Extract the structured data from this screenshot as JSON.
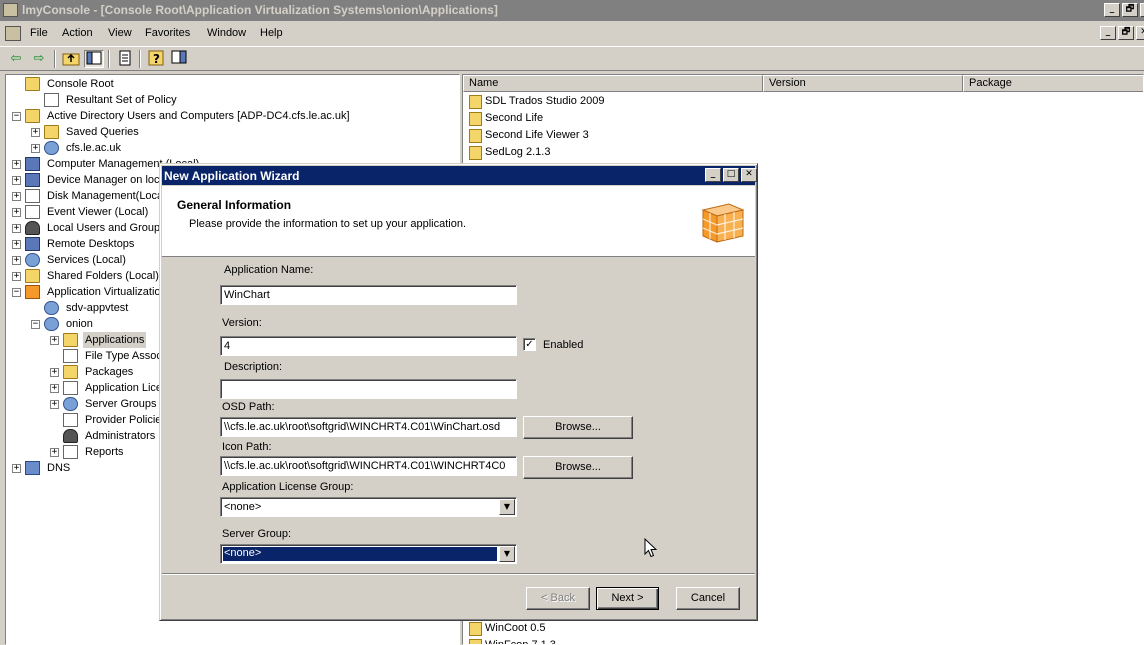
{
  "window": {
    "title": "lmyConsole - [Console Root\\Application Virtualization Systems\\onion\\Applications]",
    "controls": [
      "_",
      "🗗",
      "✕"
    ]
  },
  "menu": {
    "items": [
      "File",
      "Action",
      "View",
      "Favorites",
      "Window",
      "Help"
    ],
    "mdi_controls": [
      "_",
      "🗗",
      "✕"
    ]
  },
  "toolbar": {
    "back": "⇦",
    "forward": "⇨"
  },
  "tree": {
    "items": [
      {
        "label": "Console Root",
        "icon": "folder",
        "expander": ""
      },
      {
        "label": "Resultant Set of Policy",
        "icon": "doc",
        "expander": ""
      },
      {
        "label": "Active Directory Users and Computers [ADP-DC4.cfs.le.ac.uk]",
        "icon": "folder",
        "expander": "−"
      },
      {
        "label": "Saved Queries",
        "icon": "folder",
        "expander": "+"
      },
      {
        "label": "cfs.le.ac.uk",
        "icon": "gear",
        "expander": "+"
      },
      {
        "label": "Computer Management (Local)",
        "icon": "comp",
        "expander": "+"
      },
      {
        "label": "Device Manager on loc",
        "icon": "comp",
        "expander": "+"
      },
      {
        "label": "Disk Management(Loca",
        "icon": "doc",
        "expander": "+"
      },
      {
        "label": "Event Viewer (Local)",
        "icon": "doc",
        "expander": "+"
      },
      {
        "label": "Local Users and Groups",
        "icon": "user",
        "expander": "+"
      },
      {
        "label": "Remote Desktops",
        "icon": "comp",
        "expander": "+"
      },
      {
        "label": "Services (Local)",
        "icon": "gear",
        "expander": "+"
      },
      {
        "label": "Shared Folders (Local)",
        "icon": "folder",
        "expander": "+"
      },
      {
        "label": "Application Virtualizatio",
        "icon": "cube",
        "expander": "−"
      },
      {
        "label": "sdv-appvtest",
        "icon": "gear",
        "expander": ""
      },
      {
        "label": "onion",
        "icon": "gear",
        "expander": "−"
      },
      {
        "label": "Applications",
        "icon": "folder",
        "expander": "+"
      },
      {
        "label": "File Type Assoc",
        "icon": "doc",
        "expander": ""
      },
      {
        "label": "Packages",
        "icon": "folder",
        "expander": "+"
      },
      {
        "label": "Application Lice",
        "icon": "doc",
        "expander": "+"
      },
      {
        "label": "Server Groups",
        "icon": "gear",
        "expander": "+"
      },
      {
        "label": "Provider Policie",
        "icon": "doc",
        "expander": ""
      },
      {
        "label": "Administrators",
        "icon": "user",
        "expander": ""
      },
      {
        "label": "Reports",
        "icon": "doc",
        "expander": "+"
      },
      {
        "label": "DNS",
        "icon": "net",
        "expander": "+"
      }
    ]
  },
  "list": {
    "columns": [
      "Name",
      "Version",
      "Package"
    ],
    "rows_top": [
      "SDL Trados Studio 2009",
      "Second Life",
      "Second Life Viewer 3",
      "SedLog 2.1.3"
    ],
    "rows_bottom": [
      "WinCoot 0.5",
      "WinFcon 7.1.3"
    ]
  },
  "wizard": {
    "title": "New Application Wizard",
    "header_title": "General Information",
    "header_subtitle": "Please provide the information to set up your application.",
    "app_name_label": "Application Name:",
    "app_name_value": "WinChart",
    "version_label": "Version:",
    "version_value": "4",
    "enabled_label": "Enabled",
    "enabled_check": "✓",
    "description_label": "Description:",
    "description_value": "",
    "osd_label": "OSD Path:",
    "osd_value": "\\\\cfs.le.ac.uk\\root\\softgrid\\WINCHRT4.C01\\WinChart.osd",
    "icon_label": "Icon Path:",
    "icon_value": "\\\\cfs.le.ac.uk\\root\\softgrid\\WINCHRT4.C01\\WINCHRT4C0",
    "browse_label": "Browse...",
    "license_label": "Application License Group:",
    "license_value": "<none>",
    "server_label": "Server Group:",
    "server_value": "<none>",
    "back_label": "< Back",
    "next_label": "Next >",
    "cancel_label": "Cancel"
  }
}
